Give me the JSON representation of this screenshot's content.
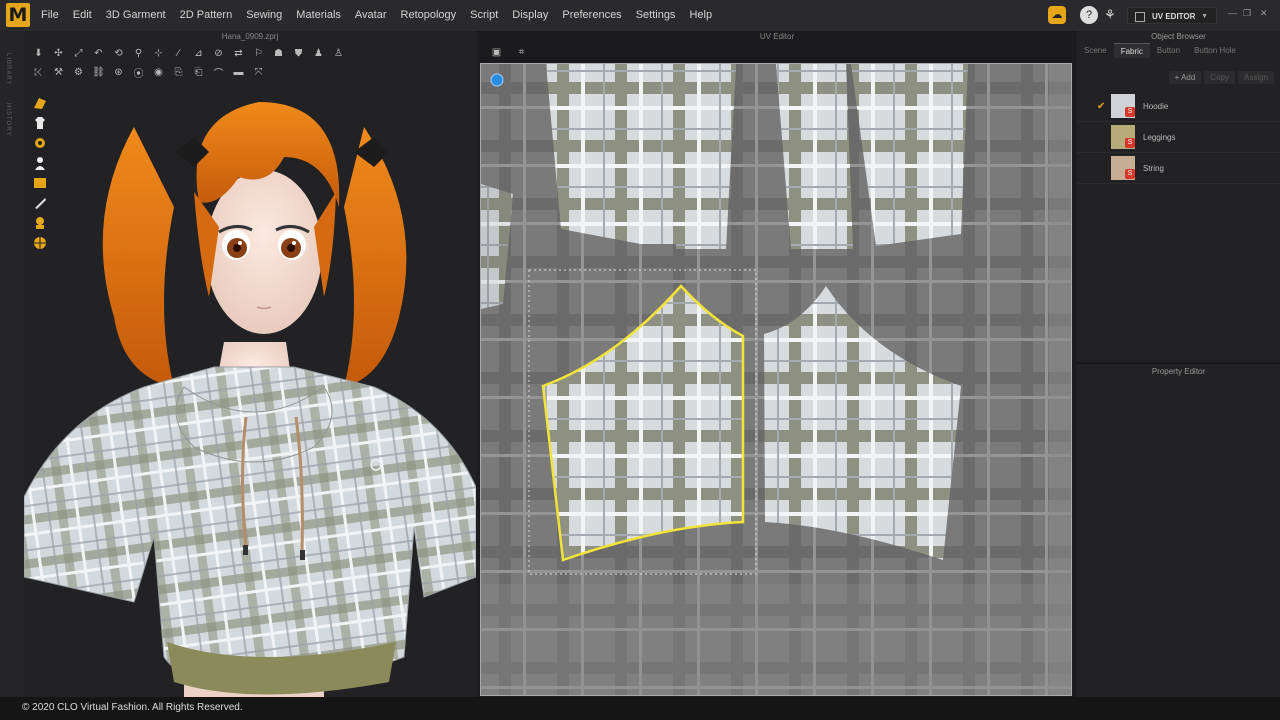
{
  "app": {
    "logo_text": "M",
    "menu": [
      "File",
      "Edit",
      "3D Garment",
      "2D Pattern",
      "Sewing",
      "Materials",
      "Avatar",
      "Retopology",
      "Script",
      "Display",
      "Preferences",
      "Settings",
      "Help"
    ],
    "mode_label": "UV EDITOR",
    "brand_color": "#e6a619"
  },
  "left_strip": {
    "labels": [
      "LIBRARY",
      "HISTORY"
    ]
  },
  "view3d": {
    "file_title": "Hana_0909.zprj"
  },
  "uv_editor": {
    "title": "UV Editor"
  },
  "object_browser": {
    "title": "Object Browser",
    "tabs": [
      "Scene",
      "Fabric",
      "Button",
      "Button Hole"
    ],
    "active_tab": "Fabric",
    "actions": [
      "Add",
      "Copy",
      "Assign"
    ],
    "fabrics": [
      {
        "name": "Hoodie",
        "checked": true,
        "swatch": "#cfd3d8"
      },
      {
        "name": "Leggings",
        "checked": false,
        "swatch": "#b6ac77"
      },
      {
        "name": "String",
        "checked": false,
        "swatch": "#c5ae94"
      }
    ]
  },
  "property_editor": {
    "title": "Property Editor"
  },
  "footer": {
    "copyright": "© 2020 CLO Virtual Fashion. All Rights Reserved."
  },
  "colors": {
    "selection_outline": "#f2e33a",
    "plaid_base": "#cfd4da"
  }
}
